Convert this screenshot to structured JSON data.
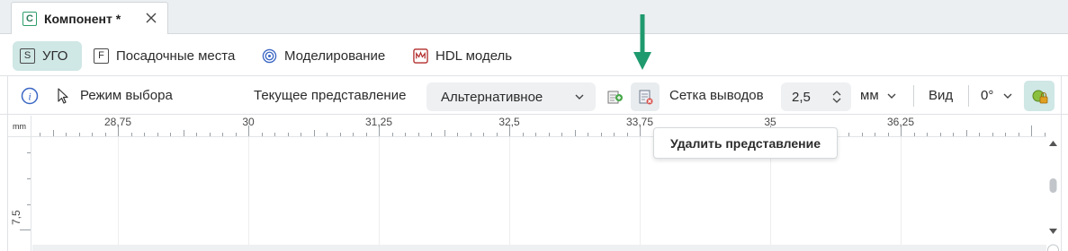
{
  "document_tab": {
    "icon_letter": "C",
    "title": "Компонент *"
  },
  "sections": [
    {
      "icon_letter": "S",
      "label": "УГО",
      "active": true
    },
    {
      "icon_letter": "F",
      "label": "Посадочные места",
      "active": false
    },
    {
      "icon": "spiral-icon",
      "label": "Моделирование",
      "active": false
    },
    {
      "icon": "hdl-icon",
      "label": "HDL модель",
      "active": false
    }
  ],
  "toolbar": {
    "mode_label": "Режим выбора",
    "representation_label": "Текущее представление",
    "representation_value": "Альтернативное",
    "grid_label": "Сетка выводов",
    "grid_value": "2,5",
    "unit_value": "мм",
    "view_label": "Вид",
    "rotation_value": "0°"
  },
  "tooltip": {
    "text": "Удалить представление"
  },
  "ruler": {
    "unit": "mm",
    "x_labels": [
      "28,75",
      "30",
      "31,25",
      "32,5",
      "33,75",
      "35",
      "36,25"
    ],
    "y_label": "7,5"
  },
  "colors": {
    "accent": "#cfe7e5",
    "annotation_arrow": "#1f9a6e",
    "delete_icon": "#d9534f"
  }
}
